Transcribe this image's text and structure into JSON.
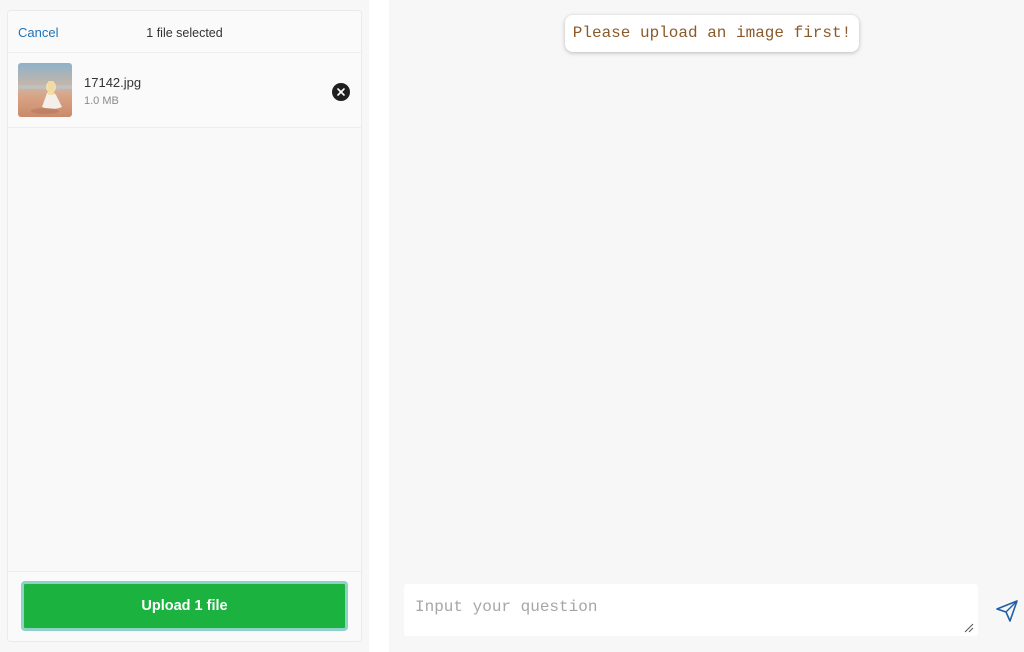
{
  "uploader": {
    "cancel_label": "Cancel",
    "selection_title": "1 file selected",
    "files": [
      {
        "name": "17142.jpg",
        "size": "1.0 MB"
      }
    ],
    "upload_label": "Upload 1 file"
  },
  "chat": {
    "message": "Please upload an image first!",
    "input_placeholder": "Input your question",
    "input_value": ""
  },
  "colors": {
    "upload_button": "#1bb240",
    "upload_button_focus_ring": "#8ed1c6",
    "cancel_link": "#1f73b7",
    "message_text": "#8b5a2b",
    "send_icon": "#1f5fa8"
  },
  "icons": {
    "remove": "close-circle-icon",
    "send": "paper-plane-icon"
  }
}
